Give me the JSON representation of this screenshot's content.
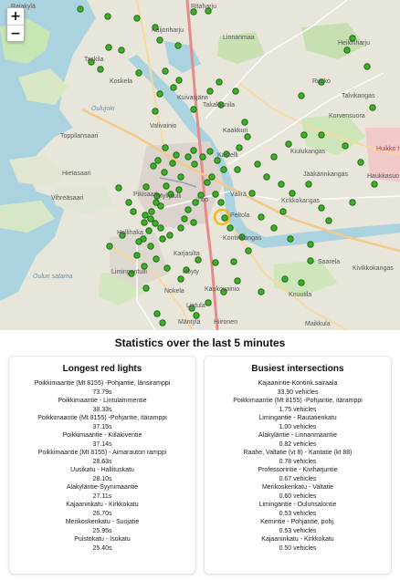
{
  "map": {
    "zoom_in": "+",
    "zoom_out": "−",
    "labels": [
      {
        "text": "Rajakylä",
        "cls": ""
      },
      {
        "text": "Ritaharju",
        "cls": ""
      },
      {
        "text": "Kaijonharju",
        "cls": ""
      },
      {
        "text": "Linnanmaa",
        "cls": ""
      },
      {
        "text": "Taskila",
        "cls": ""
      },
      {
        "text": "Koskela",
        "cls": ""
      },
      {
        "text": "Heikinharju",
        "cls": ""
      },
      {
        "text": "Rusko",
        "cls": ""
      },
      {
        "text": "Talvikangas",
        "cls": ""
      },
      {
        "text": "Kuivasjärvi",
        "cls": ""
      },
      {
        "text": "Takalaanila",
        "cls": ""
      },
      {
        "text": "Korvensuora",
        "cls": ""
      },
      {
        "text": "Toppilansaari",
        "cls": ""
      },
      {
        "text": "Valivainio",
        "cls": ""
      },
      {
        "text": "Kaakkuri",
        "cls": ""
      },
      {
        "text": "Hietasaari",
        "cls": ""
      },
      {
        "text": "Kastelli",
        "cls": ""
      },
      {
        "text": "Kiulukangas",
        "cls": ""
      },
      {
        "text": "Pikisaari",
        "cls": ""
      },
      {
        "text": "Myllytulli",
        "cls": ""
      },
      {
        "text": "Jääkärinkangas",
        "cls": ""
      },
      {
        "text": "Vihreäsaari",
        "cls": ""
      },
      {
        "text": "Intiö",
        "cls": ""
      },
      {
        "text": "Välirä",
        "cls": ""
      },
      {
        "text": "Kirkkokangas",
        "cls": ""
      },
      {
        "text": "Hollihaka",
        "cls": ""
      },
      {
        "text": "Peltola",
        "cls": ""
      },
      {
        "text": "Kontinkangas",
        "cls": ""
      },
      {
        "text": "Karjasilta",
        "cls": ""
      },
      {
        "text": "Saarela",
        "cls": ""
      },
      {
        "text": "Limingantulli",
        "cls": ""
      },
      {
        "text": "Höyty",
        "cls": ""
      },
      {
        "text": "Kivikkokangas",
        "cls": ""
      },
      {
        "text": "Nokela",
        "cls": ""
      },
      {
        "text": "Kaukovainio",
        "cls": ""
      },
      {
        "text": "Knuutila",
        "cls": ""
      },
      {
        "text": "Lintula",
        "cls": ""
      },
      {
        "text": "Mäntylä",
        "cls": ""
      },
      {
        "text": "Hiironen",
        "cls": ""
      },
      {
        "text": "Maikkula",
        "cls": ""
      },
      {
        "text": "Haukkasuo",
        "cls": ""
      },
      {
        "text": "Oulun satama",
        "cls": "w"
      },
      {
        "text": "Oulujoki",
        "cls": "w"
      },
      {
        "text": "Huikko hoitsja",
        "cls": "r"
      }
    ]
  },
  "stats": {
    "title": "Statistics over the last 5 minutes",
    "red_lights": {
      "heading": "Longest red lights",
      "rows": [
        {
          "name": "Poikkimaantie (Mt 8155) -Pohjantie, länsiramppi",
          "value": "73.79s"
        },
        {
          "name": "Poikkimaantie - Lintulammentie",
          "value": "38.33s"
        },
        {
          "name": "Poikkimaantie (Mt 8155) -Pohjantie, itäramppi",
          "value": "37.15s"
        },
        {
          "name": "Poikkimaantie - Kiilakiventie",
          "value": "37.14s"
        },
        {
          "name": "Poikkimaantie (Mt 8155) - Aimarauton ramppi",
          "value": "28.63s"
        },
        {
          "name": "Uusikatu - Hallituskatu",
          "value": "28.10s"
        },
        {
          "name": "Alakyläntie-Syynimaantie",
          "value": "27.11s"
        },
        {
          "name": "Kajaaninkatu - Kirkkokatu",
          "value": "26.70s"
        },
        {
          "name": "Merikoskenkatu - Suojatie",
          "value": "25.95s"
        },
        {
          "name": "Puistokatu - Isokatu",
          "value": "25.40s"
        }
      ]
    },
    "intersections": {
      "heading": "Busiest intersections",
      "rows": [
        {
          "name": "Kajaanintie-Kontink.sairaala",
          "value": "33.90 vehicles"
        },
        {
          "name": "Poikkimaantie (Mt 8155) -Pohjantie, itäramppi",
          "value": "1.75 vehicles"
        },
        {
          "name": "Limingantie - Rautatienkatu",
          "value": "1.00 vehicles"
        },
        {
          "name": "Alakyläntie - Linnanmaantie",
          "value": "0.82 vehicles"
        },
        {
          "name": "Raahe, Valtatie (vt 8) - Kantatie (kt 88)",
          "value": "0.78 vehicles"
        },
        {
          "name": "Professorintie - Kiviharjuntie",
          "value": "0.67 vehicles"
        },
        {
          "name": "Merikoskenkatu - Valtatie",
          "value": "0.60 vehicles"
        },
        {
          "name": "Limingantie - Oulunsalontie",
          "value": "0.53 vehicles"
        },
        {
          "name": "Kemintie - Pohjantie, pohj.",
          "value": "0.53 vehicles"
        },
        {
          "name": "Kajaaninkatu - Kirkkokatu",
          "value": "0.50 vehicles"
        }
      ]
    }
  }
}
